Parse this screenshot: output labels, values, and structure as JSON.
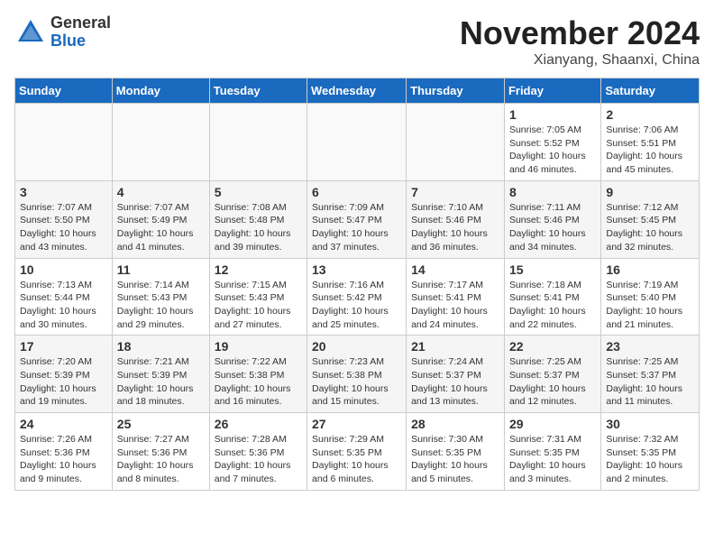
{
  "logo": {
    "general": "General",
    "blue": "Blue"
  },
  "title": "November 2024",
  "location": "Xianyang, Shaanxi, China",
  "days_of_week": [
    "Sunday",
    "Monday",
    "Tuesday",
    "Wednesday",
    "Thursday",
    "Friday",
    "Saturday"
  ],
  "weeks": [
    [
      {
        "day": "",
        "info": ""
      },
      {
        "day": "",
        "info": ""
      },
      {
        "day": "",
        "info": ""
      },
      {
        "day": "",
        "info": ""
      },
      {
        "day": "",
        "info": ""
      },
      {
        "day": "1",
        "info": "Sunrise: 7:05 AM\nSunset: 5:52 PM\nDaylight: 10 hours and 46 minutes."
      },
      {
        "day": "2",
        "info": "Sunrise: 7:06 AM\nSunset: 5:51 PM\nDaylight: 10 hours and 45 minutes."
      }
    ],
    [
      {
        "day": "3",
        "info": "Sunrise: 7:07 AM\nSunset: 5:50 PM\nDaylight: 10 hours and 43 minutes."
      },
      {
        "day": "4",
        "info": "Sunrise: 7:07 AM\nSunset: 5:49 PM\nDaylight: 10 hours and 41 minutes."
      },
      {
        "day": "5",
        "info": "Sunrise: 7:08 AM\nSunset: 5:48 PM\nDaylight: 10 hours and 39 minutes."
      },
      {
        "day": "6",
        "info": "Sunrise: 7:09 AM\nSunset: 5:47 PM\nDaylight: 10 hours and 37 minutes."
      },
      {
        "day": "7",
        "info": "Sunrise: 7:10 AM\nSunset: 5:46 PM\nDaylight: 10 hours and 36 minutes."
      },
      {
        "day": "8",
        "info": "Sunrise: 7:11 AM\nSunset: 5:46 PM\nDaylight: 10 hours and 34 minutes."
      },
      {
        "day": "9",
        "info": "Sunrise: 7:12 AM\nSunset: 5:45 PM\nDaylight: 10 hours and 32 minutes."
      }
    ],
    [
      {
        "day": "10",
        "info": "Sunrise: 7:13 AM\nSunset: 5:44 PM\nDaylight: 10 hours and 30 minutes."
      },
      {
        "day": "11",
        "info": "Sunrise: 7:14 AM\nSunset: 5:43 PM\nDaylight: 10 hours and 29 minutes."
      },
      {
        "day": "12",
        "info": "Sunrise: 7:15 AM\nSunset: 5:43 PM\nDaylight: 10 hours and 27 minutes."
      },
      {
        "day": "13",
        "info": "Sunrise: 7:16 AM\nSunset: 5:42 PM\nDaylight: 10 hours and 25 minutes."
      },
      {
        "day": "14",
        "info": "Sunrise: 7:17 AM\nSunset: 5:41 PM\nDaylight: 10 hours and 24 minutes."
      },
      {
        "day": "15",
        "info": "Sunrise: 7:18 AM\nSunset: 5:41 PM\nDaylight: 10 hours and 22 minutes."
      },
      {
        "day": "16",
        "info": "Sunrise: 7:19 AM\nSunset: 5:40 PM\nDaylight: 10 hours and 21 minutes."
      }
    ],
    [
      {
        "day": "17",
        "info": "Sunrise: 7:20 AM\nSunset: 5:39 PM\nDaylight: 10 hours and 19 minutes."
      },
      {
        "day": "18",
        "info": "Sunrise: 7:21 AM\nSunset: 5:39 PM\nDaylight: 10 hours and 18 minutes."
      },
      {
        "day": "19",
        "info": "Sunrise: 7:22 AM\nSunset: 5:38 PM\nDaylight: 10 hours and 16 minutes."
      },
      {
        "day": "20",
        "info": "Sunrise: 7:23 AM\nSunset: 5:38 PM\nDaylight: 10 hours and 15 minutes."
      },
      {
        "day": "21",
        "info": "Sunrise: 7:24 AM\nSunset: 5:37 PM\nDaylight: 10 hours and 13 minutes."
      },
      {
        "day": "22",
        "info": "Sunrise: 7:25 AM\nSunset: 5:37 PM\nDaylight: 10 hours and 12 minutes."
      },
      {
        "day": "23",
        "info": "Sunrise: 7:25 AM\nSunset: 5:37 PM\nDaylight: 10 hours and 11 minutes."
      }
    ],
    [
      {
        "day": "24",
        "info": "Sunrise: 7:26 AM\nSunset: 5:36 PM\nDaylight: 10 hours and 9 minutes."
      },
      {
        "day": "25",
        "info": "Sunrise: 7:27 AM\nSunset: 5:36 PM\nDaylight: 10 hours and 8 minutes."
      },
      {
        "day": "26",
        "info": "Sunrise: 7:28 AM\nSunset: 5:36 PM\nDaylight: 10 hours and 7 minutes."
      },
      {
        "day": "27",
        "info": "Sunrise: 7:29 AM\nSunset: 5:35 PM\nDaylight: 10 hours and 6 minutes."
      },
      {
        "day": "28",
        "info": "Sunrise: 7:30 AM\nSunset: 5:35 PM\nDaylight: 10 hours and 5 minutes."
      },
      {
        "day": "29",
        "info": "Sunrise: 7:31 AM\nSunset: 5:35 PM\nDaylight: 10 hours and 3 minutes."
      },
      {
        "day": "30",
        "info": "Sunrise: 7:32 AM\nSunset: 5:35 PM\nDaylight: 10 hours and 2 minutes."
      }
    ]
  ]
}
